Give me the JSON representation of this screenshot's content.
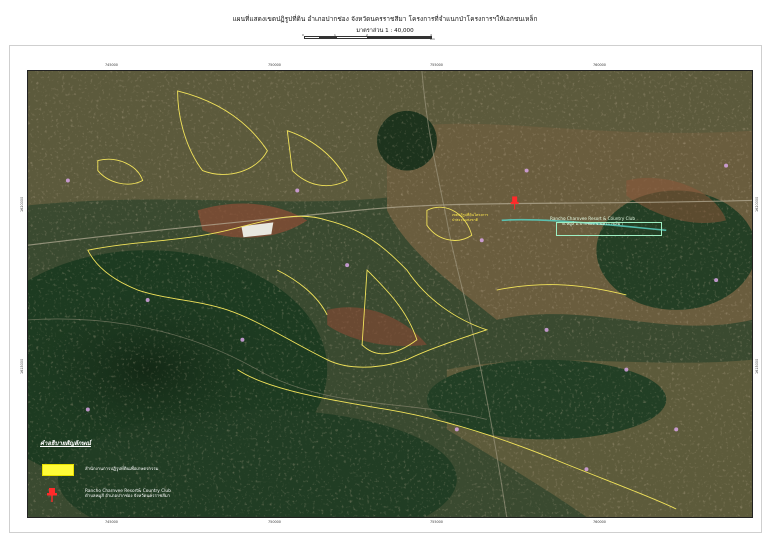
{
  "header": {
    "title": "แผนที่แสดงเขตปฏิรูปที่ดิน อำเภอปากช่อง จังหวัดนครราชสีมา โครงการที่จำแนกป่าโครงการฯให้เอกชนเหล็ก",
    "scale_label": "มาตราส่วน  1 : 40,000",
    "scalebar_labels": [
      "0",
      "1",
      "2",
      "4 Km"
    ]
  },
  "map": {
    "top_ticks": [
      "745000",
      "750000",
      "755000",
      "760000"
    ],
    "bottom_ticks": [
      "745000",
      "750000",
      "755000",
      "760000"
    ],
    "left_ticks": [
      "1620000",
      "1615000"
    ],
    "right_ticks": [
      "1620000",
      "1615000"
    ],
    "site_label": "Rancho Charnvee Resort & Country Club",
    "site_sublabel": "ต.หมูสี อ.ปากช่อง จ.นครราชสีมา",
    "yellow_label_1": "เขตปฏิรูปที่ดินโครงการ",
    "yellow_label_2": "ป่าสงวนแห่งชาติ"
  },
  "legend": {
    "title": "คำอธิบายสัญลักษณ์",
    "item1_label": "สำนักงานการปฏิรูปที่ดินเพื่อเกษตรกรรม",
    "item2_label_1": "Rancho Charnvee Resort& Country Club",
    "item2_label_2": "ตำบลหมูสี อำเภอปากช่อง จังหวัดนครราชสีมา"
  },
  "colors": {
    "boundary": "#f2e35a",
    "pin": "#ff2a2a",
    "forest": "#1d3a22",
    "farmland": "#6b5a3a"
  }
}
